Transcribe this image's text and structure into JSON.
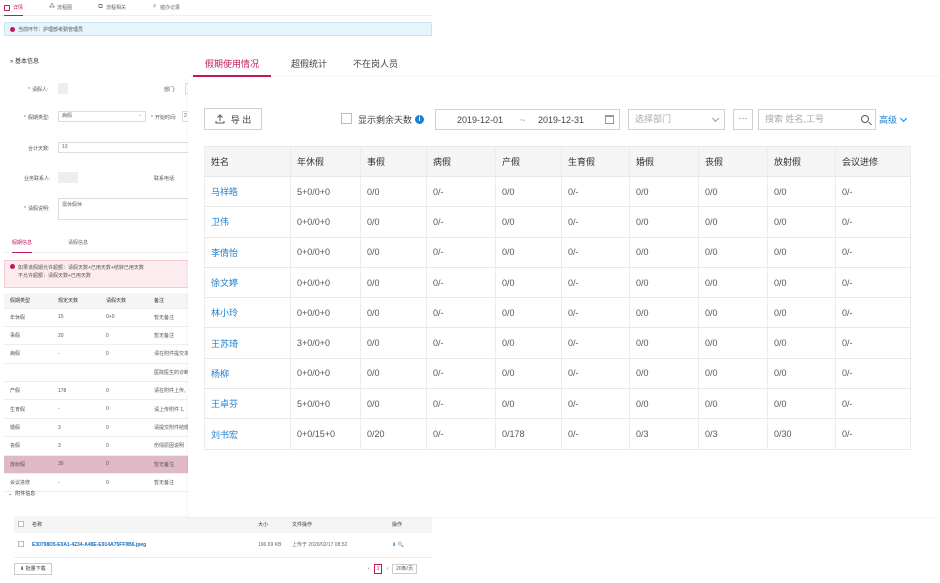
{
  "back": {
    "tabs": [
      {
        "label": "详情",
        "icon": "detail-icon"
      },
      {
        "label": "流程图",
        "icon": "flowchart-icon"
      },
      {
        "label": "流程相关",
        "icon": "related-icon"
      },
      {
        "label": "催办记录",
        "icon": "urge-icon"
      }
    ],
    "notice": "当前环节：护理部考勤管理员",
    "section_title": "» 基本信息",
    "fields": {
      "applicant_label": "请假人:",
      "applicant_value": "",
      "dept_label": "部门:",
      "leave_type_label": "假期类型:",
      "leave_type_value": "病假",
      "start_label": "开始时间:",
      "start_value": "2",
      "total_days_label": "合计天数:",
      "total_days_value": "13",
      "contact_label": "业务联系人:",
      "contact_value": "",
      "phone_label": "联系电话:",
      "reason_label": "请假说明:",
      "reason_value": "需休假休"
    },
    "sub_tabs": [
      "假期信息",
      "请假信息"
    ],
    "warning": [
      "如果该假期允许超额：请假天数+已用天数+结转已用天数",
      "不允许超额：请假天数+已用天数"
    ],
    "table_headers": [
      "假期类型",
      "规定天数",
      "请假天数",
      "备注"
    ],
    "table_rows": [
      [
        "年休假",
        "15",
        "0+0",
        "暂无备注"
      ],
      [
        "事假",
        "20",
        "0",
        "暂无备注"
      ],
      [
        "病假",
        "-",
        "0",
        "请在附件提交本"
      ],
      [
        "",
        "",
        "",
        "医院医生的诊断"
      ],
      [
        "产假",
        "178",
        "0",
        "请在附件上传,"
      ],
      [
        "生育假",
        "-",
        "0",
        "请上传附件 1,"
      ],
      [
        "婚假",
        "3",
        "0",
        "请提交附件结婚"
      ],
      [
        "丧假",
        "3",
        "0",
        "伤情原因说明"
      ],
      [
        "放射假",
        "30",
        "0",
        "暂无备注"
      ],
      [
        "会议进修",
        "-",
        "0",
        "暂无备注"
      ]
    ],
    "attach_title": "附件信息",
    "attach_headers": [
      "名称",
      "大小",
      "文件操作",
      "操作"
    ],
    "attach_row": {
      "name": "E30798D5-E0A1-4234-A48E-E914A75FF9B6.jpeg",
      "size": "196.69 KB",
      "op": "上传于 2020/02/17 08:52"
    },
    "bulk_download": "批量下载",
    "pager_current": "1",
    "pager_size": "20条/页"
  },
  "front": {
    "tabs": [
      "假期使用情况",
      "超假统计",
      "不在岗人员"
    ],
    "export_label": "导 出",
    "remain_label": "显示剩余天数",
    "date_start": "2019-12-01",
    "date_sep": "~",
    "date_end": "2019-12-31",
    "dept_placeholder": "选择部门",
    "more_label": "···",
    "search_placeholder": "搜索 姓名,工号",
    "advanced_label": "高级",
    "headers": [
      "姓名",
      "年休假",
      "事假",
      "病假",
      "产假",
      "生育假",
      "婚假",
      "丧假",
      "放射假",
      "会议进修"
    ],
    "rows": [
      [
        "马祥皓",
        "5+0/0+0",
        "0/0",
        "0/-",
        "0/0",
        "0/-",
        "0/0",
        "0/0",
        "0/0",
        "0/-"
      ],
      [
        "卫伟",
        "0+0/0+0",
        "0/0",
        "0/-",
        "0/0",
        "0/-",
        "0/0",
        "0/0",
        "0/0",
        "0/-"
      ],
      [
        "李倩怡",
        "0+0/0+0",
        "0/0",
        "0/-",
        "0/0",
        "0/-",
        "0/0",
        "0/0",
        "0/0",
        "0/-"
      ],
      [
        "徐文婷",
        "0+0/0+0",
        "0/0",
        "0/-",
        "0/0",
        "0/-",
        "0/0",
        "0/0",
        "0/0",
        "0/-"
      ],
      [
        "林小玲",
        "0+0/0+0",
        "0/0",
        "0/-",
        "0/0",
        "0/-",
        "0/0",
        "0/0",
        "0/0",
        "0/-"
      ],
      [
        "王苏琦",
        "3+0/0+0",
        "0/0",
        "0/-",
        "0/0",
        "0/-",
        "0/0",
        "0/0",
        "0/0",
        "0/-"
      ],
      [
        "杨柳",
        "0+0/0+0",
        "0/0",
        "0/-",
        "0/0",
        "0/-",
        "0/0",
        "0/0",
        "0/0",
        "0/-"
      ],
      [
        "王卓芬",
        "5+0/0+0",
        "0/0",
        "0/-",
        "0/0",
        "0/-",
        "0/0",
        "0/0",
        "0/0",
        "0/-"
      ],
      [
        "刘书宏",
        "0+0/15+0",
        "0/20",
        "0/-",
        "0/178",
        "0/-",
        "0/3",
        "0/3",
        "0/30",
        "0/-"
      ]
    ]
  }
}
